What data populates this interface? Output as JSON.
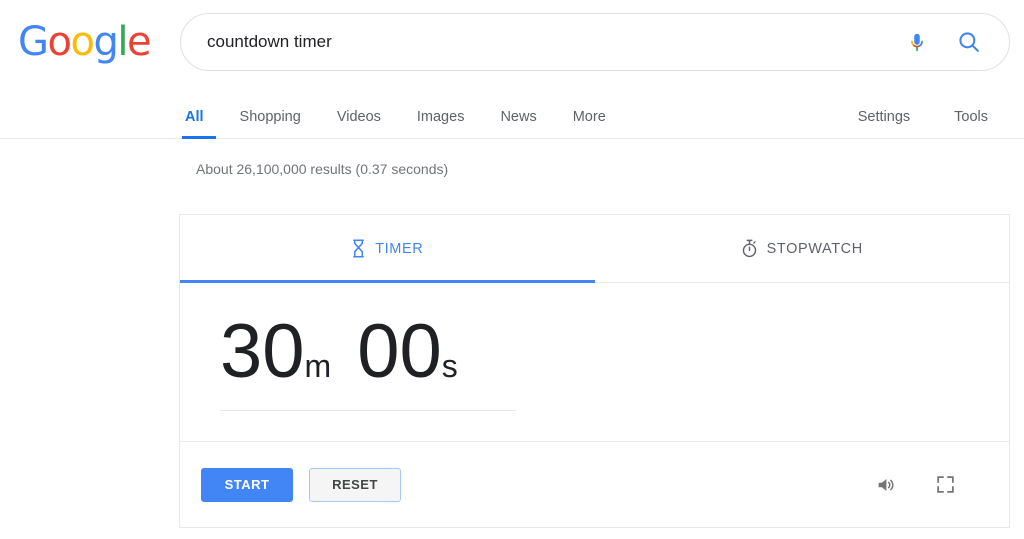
{
  "brand": {
    "logo_letters": [
      {
        "char": "G",
        "color": "#4285f4"
      },
      {
        "char": "o",
        "color": "#ea4335"
      },
      {
        "char": "o",
        "color": "#fbbc05"
      },
      {
        "char": "g",
        "color": "#4285f4"
      },
      {
        "char": "l",
        "color": "#34a853"
      },
      {
        "char": "e",
        "color": "#ea4335"
      }
    ],
    "logo_text": "Google"
  },
  "search": {
    "query": "countdown timer",
    "placeholder": "Search",
    "mic_icon": "microphone-icon",
    "search_icon": "search-icon"
  },
  "nav": {
    "tabs": [
      {
        "label": "All",
        "active": true
      },
      {
        "label": "Shopping",
        "active": false
      },
      {
        "label": "Videos",
        "active": false
      },
      {
        "label": "Images",
        "active": false
      },
      {
        "label": "News",
        "active": false
      },
      {
        "label": "More",
        "active": false
      }
    ],
    "right_items": [
      {
        "label": "Settings"
      },
      {
        "label": "Tools"
      }
    ]
  },
  "results": {
    "stats": "About 26,100,000 results (0.37 seconds)"
  },
  "widget": {
    "tabs": [
      {
        "label": "TIMER",
        "icon": "hourglass-icon",
        "active": true
      },
      {
        "label": "STOPWATCH",
        "icon": "stopwatch-icon",
        "active": false
      }
    ],
    "timer": {
      "minutes": "30",
      "minutes_unit": "m",
      "seconds": "00",
      "seconds_unit": "s",
      "full_value": "30m 00s"
    },
    "controls": {
      "start_label": "START",
      "reset_label": "RESET",
      "sound_icon": "sound-on-icon",
      "fullscreen_icon": "fullscreen-icon"
    }
  },
  "colors": {
    "accent_blue": "#4285f4",
    "nav_active_blue": "#1a73e8",
    "text_primary": "#202124",
    "text_secondary": "#5f6368",
    "stats_gray": "#70757a",
    "border_gray": "#e8e8e8"
  }
}
